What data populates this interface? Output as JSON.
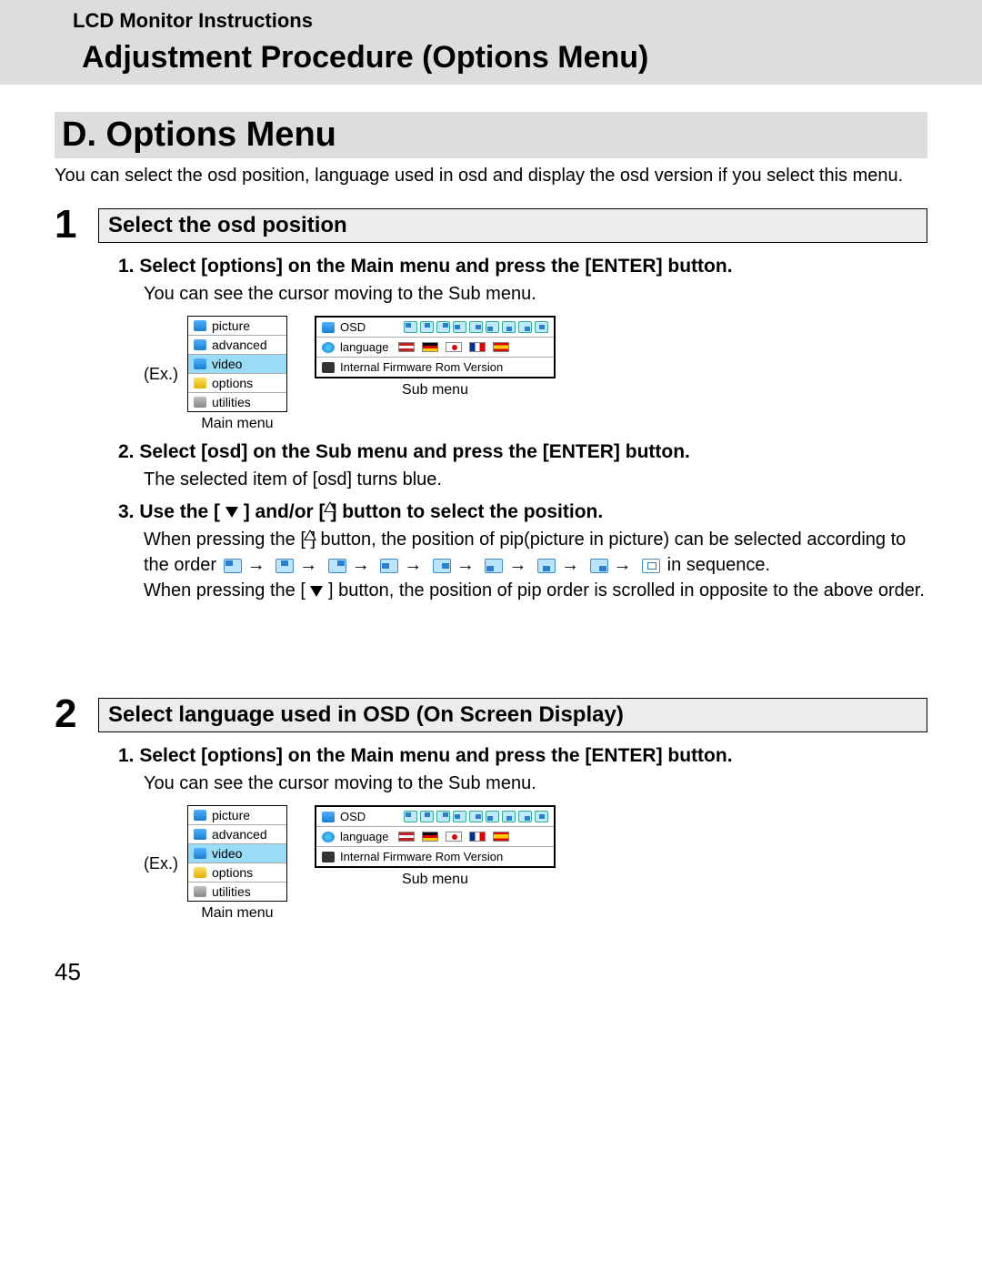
{
  "header": {
    "small": "LCD Monitor Instructions",
    "big": "Adjustment Procedure (Options Menu)"
  },
  "section": {
    "title": "D. Options Menu",
    "intro": "You can select the osd position, language used in osd and display the osd version if you select this menu."
  },
  "step1": {
    "num": "1",
    "title": "Select the osd position",
    "sub1": {
      "num": "1.",
      "title": "Select [options] on the Main menu and press the [ENTER] button.",
      "desc": "You can see the cursor moving to the Sub menu."
    },
    "sub2": {
      "num": "2.",
      "title": "Select [osd] on the Sub menu and press the [ENTER] button.",
      "desc": "The selected item of [osd] turns blue."
    },
    "sub3": {
      "num": "3.",
      "title_a": "Use the [ ",
      "title_b": " ] and/or [ ",
      "title_c": " ] button to select the position.",
      "desc1_a": "When pressing the [ ",
      "desc1_b": " ] button, the position of pip(picture in picture) can be selected according to the order ",
      "desc1_c": " in sequence.",
      "desc2_a": "When pressing the [ ",
      "desc2_b": " ] button, the position of pip order is scrolled in opposite to the above order."
    }
  },
  "step2": {
    "num": "2",
    "title": "Select language used in OSD (On Screen Display)",
    "sub1": {
      "num": "1.",
      "title": "Select [options] on the Main menu and press the [ENTER] button.",
      "desc": "You can see the cursor moving to the Sub menu."
    }
  },
  "labels": {
    "ex": "(Ex.)",
    "main_menu": "Main menu",
    "sub_menu": "Sub menu"
  },
  "main_menu_items": {
    "i0": "picture",
    "i1": "advanced",
    "i2": "video",
    "i3": "options",
    "i4": "utilities"
  },
  "sub_menu_items": {
    "osd": "OSD",
    "language": "language",
    "firmware": "Internal  Firmware Rom Version"
  },
  "page_number": "45"
}
